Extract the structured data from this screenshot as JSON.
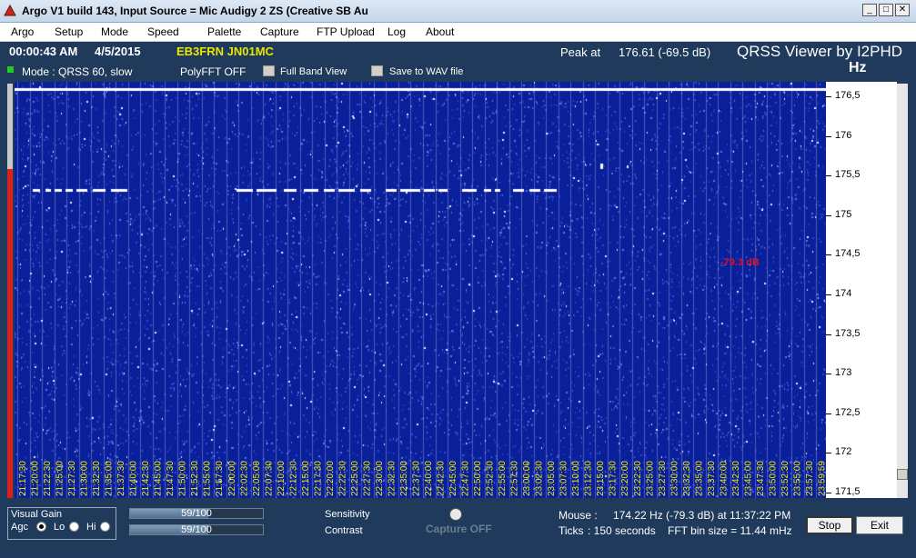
{
  "window": {
    "title": "Argo V1 build 143, Input Source = Mic Audigy 2 ZS (Creative SB Au",
    "minimize_symbol": "_",
    "maximize_symbol": "□",
    "close_symbol": "✕"
  },
  "menu": [
    "Argo",
    "Setup",
    "Mode",
    "Speed",
    "Palette",
    "Capture",
    "FTP Upload",
    "Log",
    "About"
  ],
  "header": {
    "time": "00:00:43 AM",
    "date": "4/5/2015",
    "callsign": "EB3FRN JN01MC",
    "peak_label": "Peak at",
    "peak_value": "176.61 (-69.5 dB)",
    "viewer_title": "QRSS Viewer by I2PHD",
    "unit": "Hz",
    "mode": "Mode : QRSS 60, slow",
    "polyfft": "PolyFFT OFF",
    "full_band_view": "Full Band View",
    "save_to_wav": "Save to WAV file"
  },
  "waterfall": {
    "cursor_readout": "-79.3 dB",
    "colors": {
      "background": "#0a1f9a",
      "noise": "#4a62e0",
      "signal": "#ffffff",
      "time_labels": "#f0f000"
    },
    "time_labels": [
      "21:17:30",
      "21:20:00",
      "21:22:30",
      "21:25:00",
      "21:27:30",
      "21:30:00",
      "21:32:30",
      "21:35:00",
      "21:37:30",
      "21:40:00",
      "21:42:30",
      "21:45:00",
      "21:47:30",
      "21:50:00",
      "21:52:30",
      "21:55:00",
      "21:57:30",
      "22:00:00",
      "22:02:30",
      "22:05:00",
      "22:07:30",
      "22:10:00",
      "22:12:30",
      "22:15:00",
      "22:17:30",
      "22:20:00",
      "22:22:30",
      "22:25:00",
      "22:27:30",
      "22:30:00",
      "22:32:30",
      "22:35:00",
      "22:37:30",
      "22:40:00",
      "22:42:30",
      "22:45:00",
      "22:47:30",
      "22:50:00",
      "22:52:30",
      "22:55:00",
      "22:57:30",
      "23:00:00",
      "23:02:30",
      "23:05:00",
      "23:07:30",
      "23:10:00",
      "23:12:30",
      "23:15:00",
      "23:17:30",
      "23:20:00",
      "23:22:30",
      "23:25:00",
      "23:27:30",
      "23:30:00",
      "23:32:30",
      "23:35:00",
      "23:37:30",
      "23:40:00",
      "23:42:30",
      "23:45:00",
      "23:47:30",
      "23:50:00",
      "23:52:30",
      "23:55:00",
      "23:57:30",
      "23:59:59"
    ]
  },
  "frequency_scale": [
    "176,5",
    "176",
    "175,5",
    "175",
    "174,5",
    "174",
    "173,5",
    "173",
    "172,5",
    "172",
    "171,5"
  ],
  "bottom": {
    "visual_gain_label": "Visual Gain",
    "agc_label": "Agc",
    "lo_label": "Lo",
    "hi_label": "Hi",
    "agc_selected": true,
    "sensitivity_value": "59/100",
    "sensitivity_fraction": 0.59,
    "sensitivity_label": "Sensitivity",
    "contrast_value": "59/100",
    "contrast_fraction": 0.59,
    "contrast_label": "Contrast",
    "capture_label": "Capture OFF",
    "mouse_label": "Mouse :",
    "mouse_value": "174.22 Hz",
    "mouse_detail": "(-79.3 dB) at 11:37:22 PM",
    "ticks_label": "Ticks",
    "ticks_value": ": 150 seconds",
    "fft_bin": "FFT bin size = 11.44 mHz",
    "stop_label": "Stop",
    "exit_label": "Exit"
  }
}
